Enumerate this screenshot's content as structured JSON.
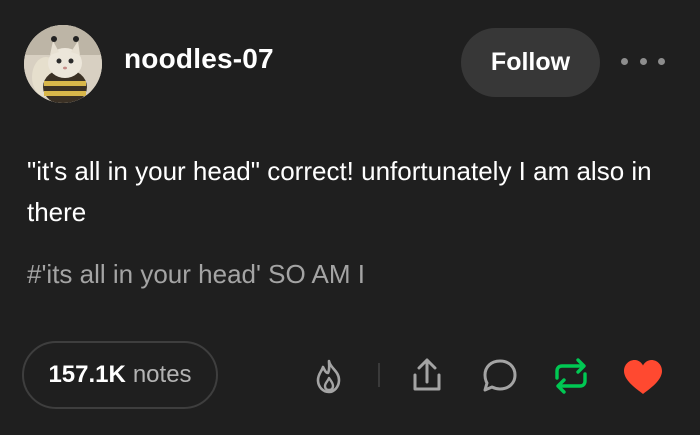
{
  "post": {
    "username": "noodles-07",
    "follow_label": "Follow",
    "body": "\"it's all in your head\" correct! unfortunately I am also in there",
    "tags": "#'its all in your head' SO AM I"
  },
  "footer": {
    "notes_count": "157.1K",
    "notes_label": "notes",
    "icons": [
      "fire-icon",
      "share-icon",
      "reply-icon",
      "reblog-icon",
      "like-icon"
    ],
    "colors": {
      "reblog": "#00c853",
      "like": "#ff4930",
      "muted": "#a4a4a4"
    }
  }
}
